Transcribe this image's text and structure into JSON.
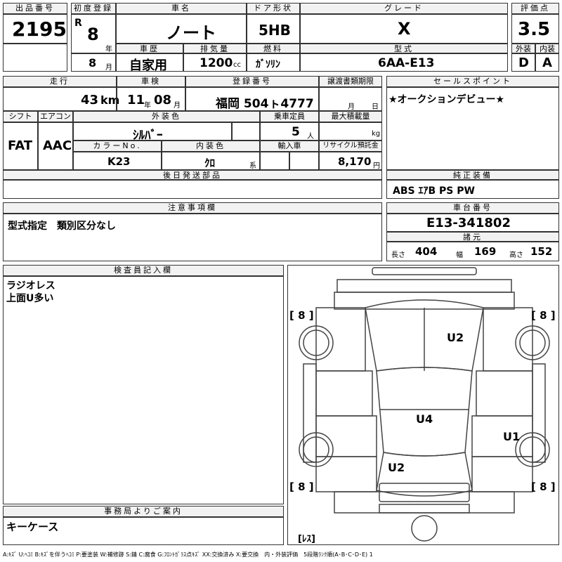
{
  "lot": {
    "label": "出品番号",
    "value": "2195"
  },
  "first_reg": {
    "label": "初度登録",
    "era": "R",
    "year": "8",
    "year_unit": "年",
    "month": "8",
    "month_unit": "月"
  },
  "car_name": {
    "label": "車名",
    "value": "ノート"
  },
  "history": {
    "label": "車歴",
    "value": "自家用"
  },
  "displacement": {
    "label": "排気量",
    "value": "1200",
    "unit": "cc"
  },
  "door": {
    "label": "ドア形状",
    "value": "5HB"
  },
  "fuel": {
    "label": "燃料",
    "value": "ｶﾞｿﾘﾝ"
  },
  "grade": {
    "label": "グレード",
    "value": "X"
  },
  "model": {
    "label": "型式",
    "value": "6AA-E13"
  },
  "score": {
    "label": "評価点",
    "value": "3.5",
    "ext_label": "外装",
    "int_label": "内装",
    "ext": "D",
    "int": "A"
  },
  "mileage": {
    "label": "走行",
    "value": "43",
    "unit": "km"
  },
  "inspection": {
    "label": "車検",
    "year": "11",
    "year_unit": "年",
    "month": "08",
    "month_unit": "月"
  },
  "registration": {
    "label": "登録番号",
    "value": "福岡 504ㇳ4777"
  },
  "transfer": {
    "label": "譲渡書類期限",
    "month_unit": "月",
    "day_unit": "日"
  },
  "sales_point": {
    "label": "セールスポイント",
    "value": "★オークションデビュー★"
  },
  "shift": {
    "label": "シフト",
    "value": "FAT"
  },
  "aircon": {
    "label": "エアコン",
    "value": "AAC"
  },
  "ext_color": {
    "label": "外装色",
    "value": "ｼﾙﾊﾞｰ"
  },
  "capacity": {
    "label": "乗車定員",
    "value": "5",
    "unit": "人"
  },
  "max_load": {
    "label": "最大積載量",
    "unit": "kg"
  },
  "color_no": {
    "label": "カラーNo.",
    "value": "K23"
  },
  "int_color": {
    "label": "内装色",
    "value": "ｸﾛ",
    "unit": "系"
  },
  "import": {
    "label": "輸入車"
  },
  "recycle": {
    "label": "リサイクル預託金",
    "value": "8,170",
    "unit": "円"
  },
  "later_parts": {
    "label": "後日発送部品"
  },
  "equipment": {
    "label": "純正装備",
    "value": "ABS ｴｱB PS PW"
  },
  "caution": {
    "label": "注意事項欄",
    "value": "型式指定　類別区分なし"
  },
  "chassis": {
    "label": "車台番号",
    "value": "E13-341802"
  },
  "specs": {
    "label": "諸元",
    "length_label": "長さ",
    "length": "404",
    "width_label": "幅",
    "width": "169",
    "height_label": "高さ",
    "height": "152"
  },
  "inspector": {
    "label": "検査員記入欄",
    "lines": [
      "ラジオレス",
      "上面U多い"
    ]
  },
  "office": {
    "label": "事務局よりご案内",
    "value": "キーケース"
  },
  "diagram": {
    "tire_fl": "[ 8 ]",
    "tire_fr": "[ 8 ]",
    "tire_rl": "[ 8 ]",
    "tire_rr": "[ 8 ]",
    "mark_hood": "U2",
    "mark_roof": "U4",
    "mark_right": "U1",
    "mark_rear": "U2",
    "spare": "[ﾚｽ]"
  },
  "legend": "A:ｷｽﾞ U:ﾍｺﾐ B:ｷｽﾞを伴うﾍｺﾐ P:要塗装 W:補修跡 S:錆 C:腐食 G:ﾌﾛﾝﾄｶﾞﾗｽ点ｷｽﾞ XX:交換済み X:要交換　内・外装評価　5段階ﾗﾝｸ順(A･B･C･D･E) 1"
}
